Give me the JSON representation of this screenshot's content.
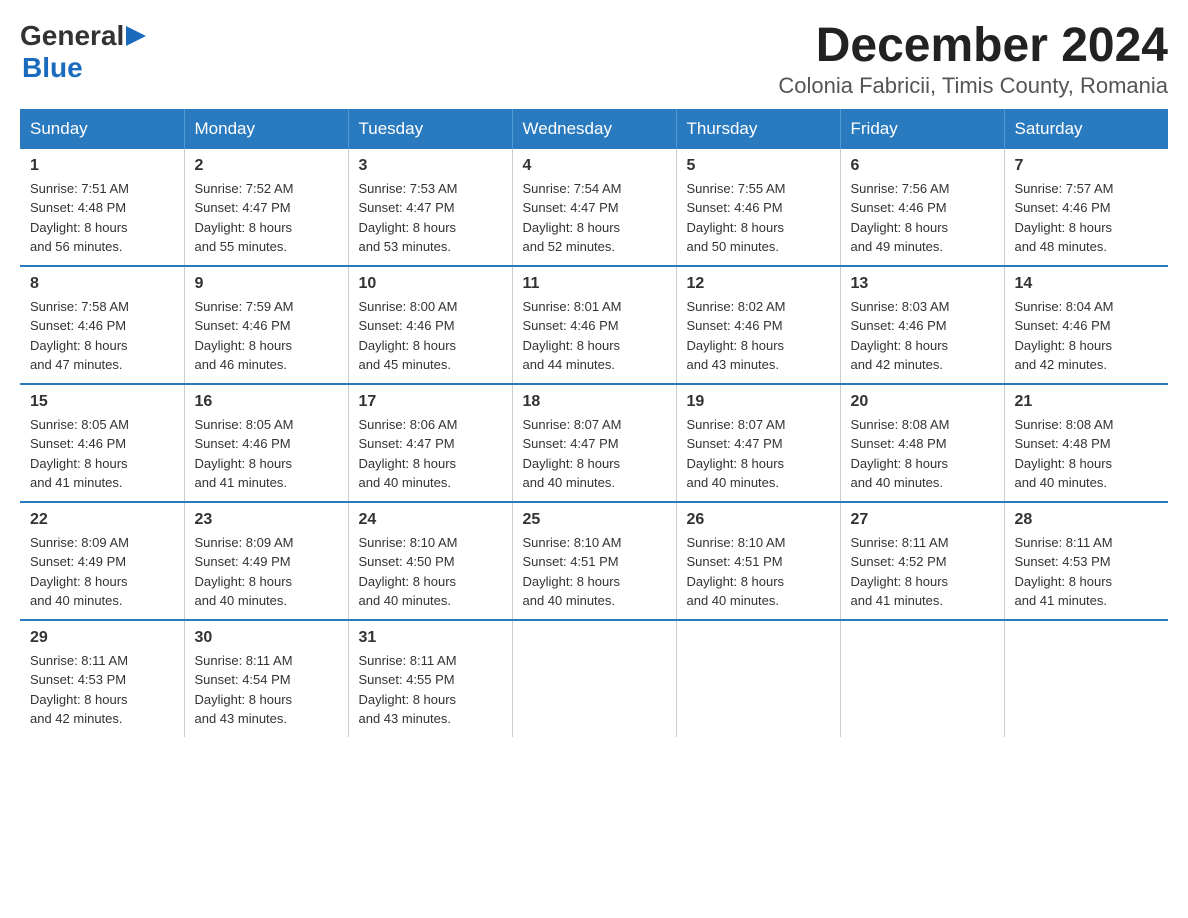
{
  "header": {
    "logo_general": "General",
    "logo_blue": "Blue",
    "title": "December 2024",
    "subtitle": "Colonia Fabricii, Timis County, Romania"
  },
  "weekdays": [
    "Sunday",
    "Monday",
    "Tuesday",
    "Wednesday",
    "Thursday",
    "Friday",
    "Saturday"
  ],
  "weeks": [
    [
      {
        "day": "1",
        "sunrise": "7:51 AM",
        "sunset": "4:48 PM",
        "daylight": "8 hours and 56 minutes."
      },
      {
        "day": "2",
        "sunrise": "7:52 AM",
        "sunset": "4:47 PM",
        "daylight": "8 hours and 55 minutes."
      },
      {
        "day": "3",
        "sunrise": "7:53 AM",
        "sunset": "4:47 PM",
        "daylight": "8 hours and 53 minutes."
      },
      {
        "day": "4",
        "sunrise": "7:54 AM",
        "sunset": "4:47 PM",
        "daylight": "8 hours and 52 minutes."
      },
      {
        "day": "5",
        "sunrise": "7:55 AM",
        "sunset": "4:46 PM",
        "daylight": "8 hours and 50 minutes."
      },
      {
        "day": "6",
        "sunrise": "7:56 AM",
        "sunset": "4:46 PM",
        "daylight": "8 hours and 49 minutes."
      },
      {
        "day": "7",
        "sunrise": "7:57 AM",
        "sunset": "4:46 PM",
        "daylight": "8 hours and 48 minutes."
      }
    ],
    [
      {
        "day": "8",
        "sunrise": "7:58 AM",
        "sunset": "4:46 PM",
        "daylight": "8 hours and 47 minutes."
      },
      {
        "day": "9",
        "sunrise": "7:59 AM",
        "sunset": "4:46 PM",
        "daylight": "8 hours and 46 minutes."
      },
      {
        "day": "10",
        "sunrise": "8:00 AM",
        "sunset": "4:46 PM",
        "daylight": "8 hours and 45 minutes."
      },
      {
        "day": "11",
        "sunrise": "8:01 AM",
        "sunset": "4:46 PM",
        "daylight": "8 hours and 44 minutes."
      },
      {
        "day": "12",
        "sunrise": "8:02 AM",
        "sunset": "4:46 PM",
        "daylight": "8 hours and 43 minutes."
      },
      {
        "day": "13",
        "sunrise": "8:03 AM",
        "sunset": "4:46 PM",
        "daylight": "8 hours and 42 minutes."
      },
      {
        "day": "14",
        "sunrise": "8:04 AM",
        "sunset": "4:46 PM",
        "daylight": "8 hours and 42 minutes."
      }
    ],
    [
      {
        "day": "15",
        "sunrise": "8:05 AM",
        "sunset": "4:46 PM",
        "daylight": "8 hours and 41 minutes."
      },
      {
        "day": "16",
        "sunrise": "8:05 AM",
        "sunset": "4:46 PM",
        "daylight": "8 hours and 41 minutes."
      },
      {
        "day": "17",
        "sunrise": "8:06 AM",
        "sunset": "4:47 PM",
        "daylight": "8 hours and 40 minutes."
      },
      {
        "day": "18",
        "sunrise": "8:07 AM",
        "sunset": "4:47 PM",
        "daylight": "8 hours and 40 minutes."
      },
      {
        "day": "19",
        "sunrise": "8:07 AM",
        "sunset": "4:47 PM",
        "daylight": "8 hours and 40 minutes."
      },
      {
        "day": "20",
        "sunrise": "8:08 AM",
        "sunset": "4:48 PM",
        "daylight": "8 hours and 40 minutes."
      },
      {
        "day": "21",
        "sunrise": "8:08 AM",
        "sunset": "4:48 PM",
        "daylight": "8 hours and 40 minutes."
      }
    ],
    [
      {
        "day": "22",
        "sunrise": "8:09 AM",
        "sunset": "4:49 PM",
        "daylight": "8 hours and 40 minutes."
      },
      {
        "day": "23",
        "sunrise": "8:09 AM",
        "sunset": "4:49 PM",
        "daylight": "8 hours and 40 minutes."
      },
      {
        "day": "24",
        "sunrise": "8:10 AM",
        "sunset": "4:50 PM",
        "daylight": "8 hours and 40 minutes."
      },
      {
        "day": "25",
        "sunrise": "8:10 AM",
        "sunset": "4:51 PM",
        "daylight": "8 hours and 40 minutes."
      },
      {
        "day": "26",
        "sunrise": "8:10 AM",
        "sunset": "4:51 PM",
        "daylight": "8 hours and 40 minutes."
      },
      {
        "day": "27",
        "sunrise": "8:11 AM",
        "sunset": "4:52 PM",
        "daylight": "8 hours and 41 minutes."
      },
      {
        "day": "28",
        "sunrise": "8:11 AM",
        "sunset": "4:53 PM",
        "daylight": "8 hours and 41 minutes."
      }
    ],
    [
      {
        "day": "29",
        "sunrise": "8:11 AM",
        "sunset": "4:53 PM",
        "daylight": "8 hours and 42 minutes."
      },
      {
        "day": "30",
        "sunrise": "8:11 AM",
        "sunset": "4:54 PM",
        "daylight": "8 hours and 43 minutes."
      },
      {
        "day": "31",
        "sunrise": "8:11 AM",
        "sunset": "4:55 PM",
        "daylight": "8 hours and 43 minutes."
      },
      null,
      null,
      null,
      null
    ]
  ]
}
